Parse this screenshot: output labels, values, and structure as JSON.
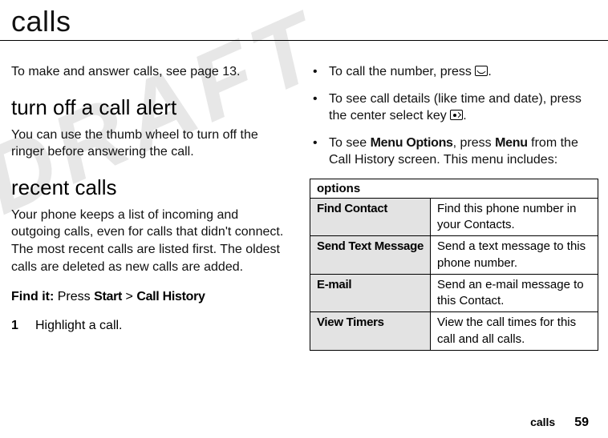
{
  "watermark": "DRAFT",
  "title": "calls",
  "left": {
    "intro": "To make and answer calls, see page 13.",
    "section1_head": "turn off a call alert",
    "section1_body": "You can use the thumb wheel to turn off the ringer before answering the call.",
    "section2_head": "recent calls",
    "section2_body": "Your phone keeps a list of incoming and outgoing calls, even for calls that didn't connect. The most recent calls are listed first. The oldest calls are deleted as new calls are added.",
    "findit_label": "Find it:",
    "findit_pre": " Press ",
    "findit_start": "Start",
    "findit_sep": " > ",
    "findit_dest": "Call History",
    "step_num": "1",
    "step_text": "Highlight a call."
  },
  "right": {
    "bullet1_pre": "To call the number, press ",
    "bullet1_post": ".",
    "bullet2_pre": "To see call details (like time and date), press the center select key ",
    "bullet2_post": ".",
    "bullet3_pre": "To see ",
    "bullet3_bold1": "Menu Options",
    "bullet3_mid": ", press ",
    "bullet3_bold2": "Menu",
    "bullet3_post": " from the Call History screen. This menu includes:"
  },
  "table": {
    "header": "options",
    "rows": [
      {
        "label": "Find Contact",
        "desc": "Find this phone number in your Contacts."
      },
      {
        "label": "Send Text Message",
        "desc": "Send a text message to this phone number."
      },
      {
        "label": "E-mail",
        "desc": "Send an e-mail message to this Contact."
      },
      {
        "label": "View Timers",
        "desc": "View the call times for this call and all calls."
      }
    ]
  },
  "footer": {
    "name": "calls",
    "num": "59"
  }
}
